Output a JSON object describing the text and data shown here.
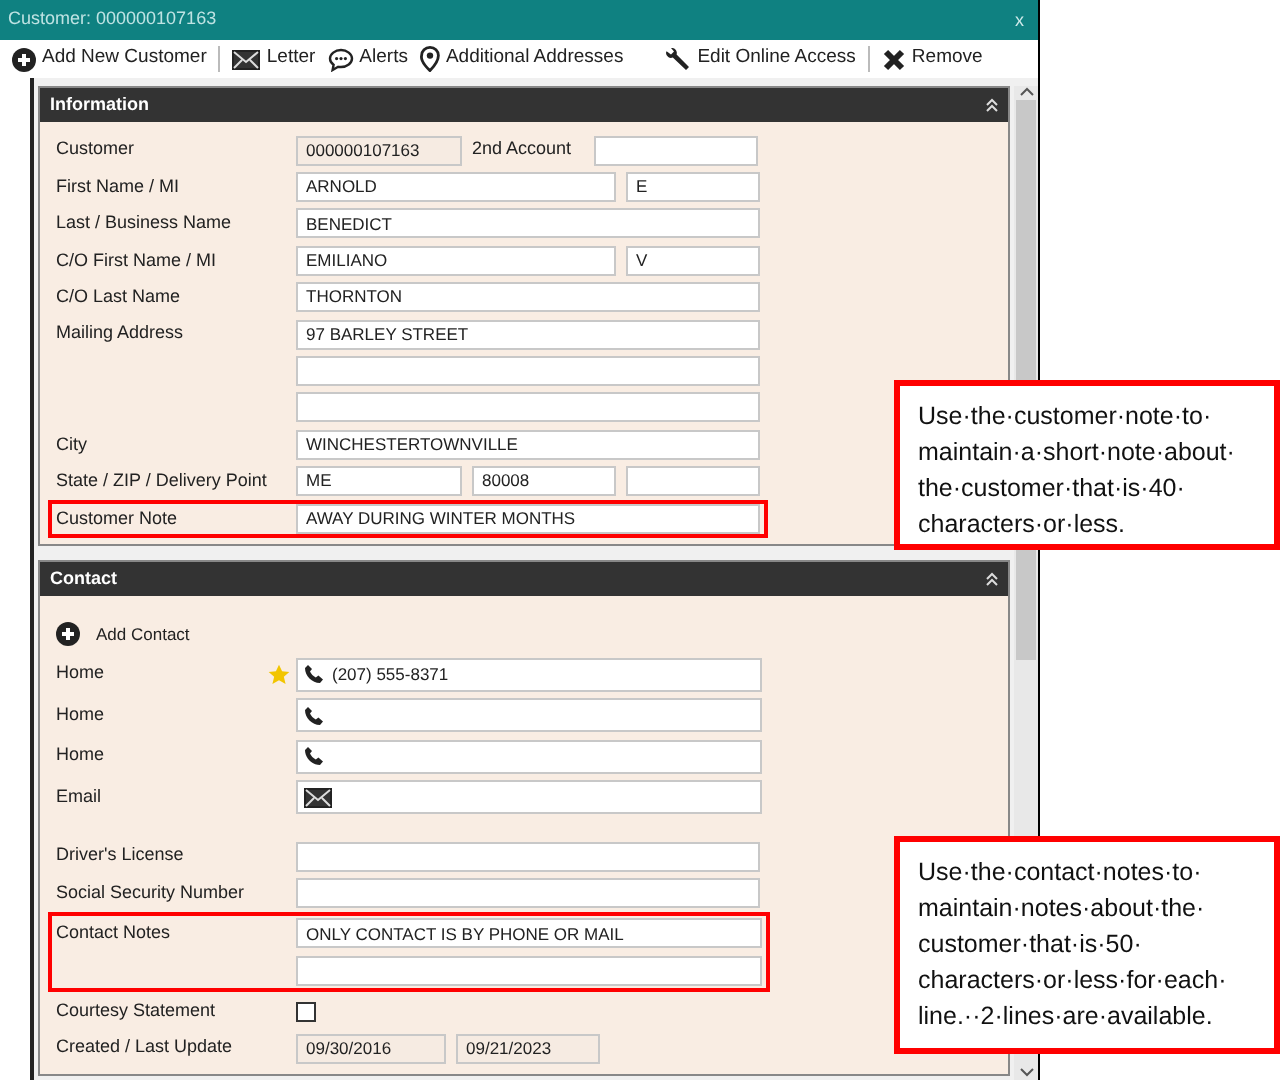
{
  "window": {
    "title": "Customer: 000000107163",
    "close": "x"
  },
  "toolbar": [
    {
      "kind": "add",
      "label": "Add New Customer"
    },
    {
      "kind": "letter",
      "label": "Letter"
    },
    {
      "kind": "alerts",
      "label": "Alerts"
    },
    {
      "kind": "pin",
      "label": "Additional Addresses"
    },
    {
      "kind": "wrench",
      "label": "Edit Online Access"
    },
    {
      "kind": "remove",
      "label": "Remove"
    }
  ],
  "information": {
    "title": "Information",
    "rows": [
      {
        "kind": "account",
        "label": "Customer",
        "value": "000000107163",
        "label_2": "2nd Account"
      },
      {
        "kind": "name_mi",
        "label": "First Name / MI",
        "value": "ARNOLD",
        "mi": "E"
      },
      {
        "kind": "text",
        "label": "Last / Business Name",
        "value": "BENEDICT"
      },
      {
        "kind": "name_mi",
        "label": "C/O First Name / MI",
        "value": "EMILIANO",
        "mi": "V"
      },
      {
        "kind": "text",
        "label": "C/O Last Name",
        "value": "THORNTON"
      },
      {
        "kind": "text",
        "label": "Mailing Address",
        "value": "97 BARLEY STREET"
      },
      {
        "kind": "text"
      },
      {
        "kind": "text"
      },
      {
        "kind": "text",
        "label": "City",
        "value": "WINCHESTERTOWNVILLE"
      },
      {
        "kind": "state_zip",
        "label": "State / ZIP / Delivery Point",
        "state": "ME",
        "zip": "80008"
      },
      {
        "kind": "text",
        "label": "Customer Note",
        "value": "AWAY DURING WINTER MONTHS",
        "highlighted": true
      }
    ]
  },
  "contact": {
    "title": "Contact",
    "add_label": "Add Contact",
    "contacts": [
      {
        "label": "Home",
        "kind": "phone",
        "primary": true,
        "value": "(207) 555-8371"
      },
      {
        "label": "Home",
        "kind": "phone",
        "primary": false
      },
      {
        "label": "Home",
        "kind": "phone",
        "primary": false
      },
      {
        "label": "Email",
        "kind": "email",
        "primary": false
      }
    ],
    "rows": [
      {
        "kind": "text",
        "label": "Driver's License"
      },
      {
        "kind": "text",
        "label": "Social Security Number"
      },
      {
        "kind": "notes",
        "label": "Contact Notes",
        "highlighted": true,
        "lines": [
          {
            "kind": "text",
            "value": "ONLY CONTACT IS BY PHONE OR MAIL"
          },
          {
            "kind": "text"
          }
        ]
      },
      {
        "kind": "checkbox",
        "label": "Courtesy Statement",
        "checked": false
      },
      {
        "kind": "dates",
        "label": "Created / Last Update",
        "created": "09/30/2016",
        "updated": "09/21/2023"
      }
    ]
  },
  "callouts": [
    {
      "text": "Use·the·customer·note·to·maintain·a·short·note·about·the·customer·that·is·40·characters·or·less."
    },
    {
      "text": "Use·the·contact·notes·to·maintain·notes·about·the·customer·that·is·50·characters·or·less·for·each·line.··2·lines·are·available."
    }
  ]
}
